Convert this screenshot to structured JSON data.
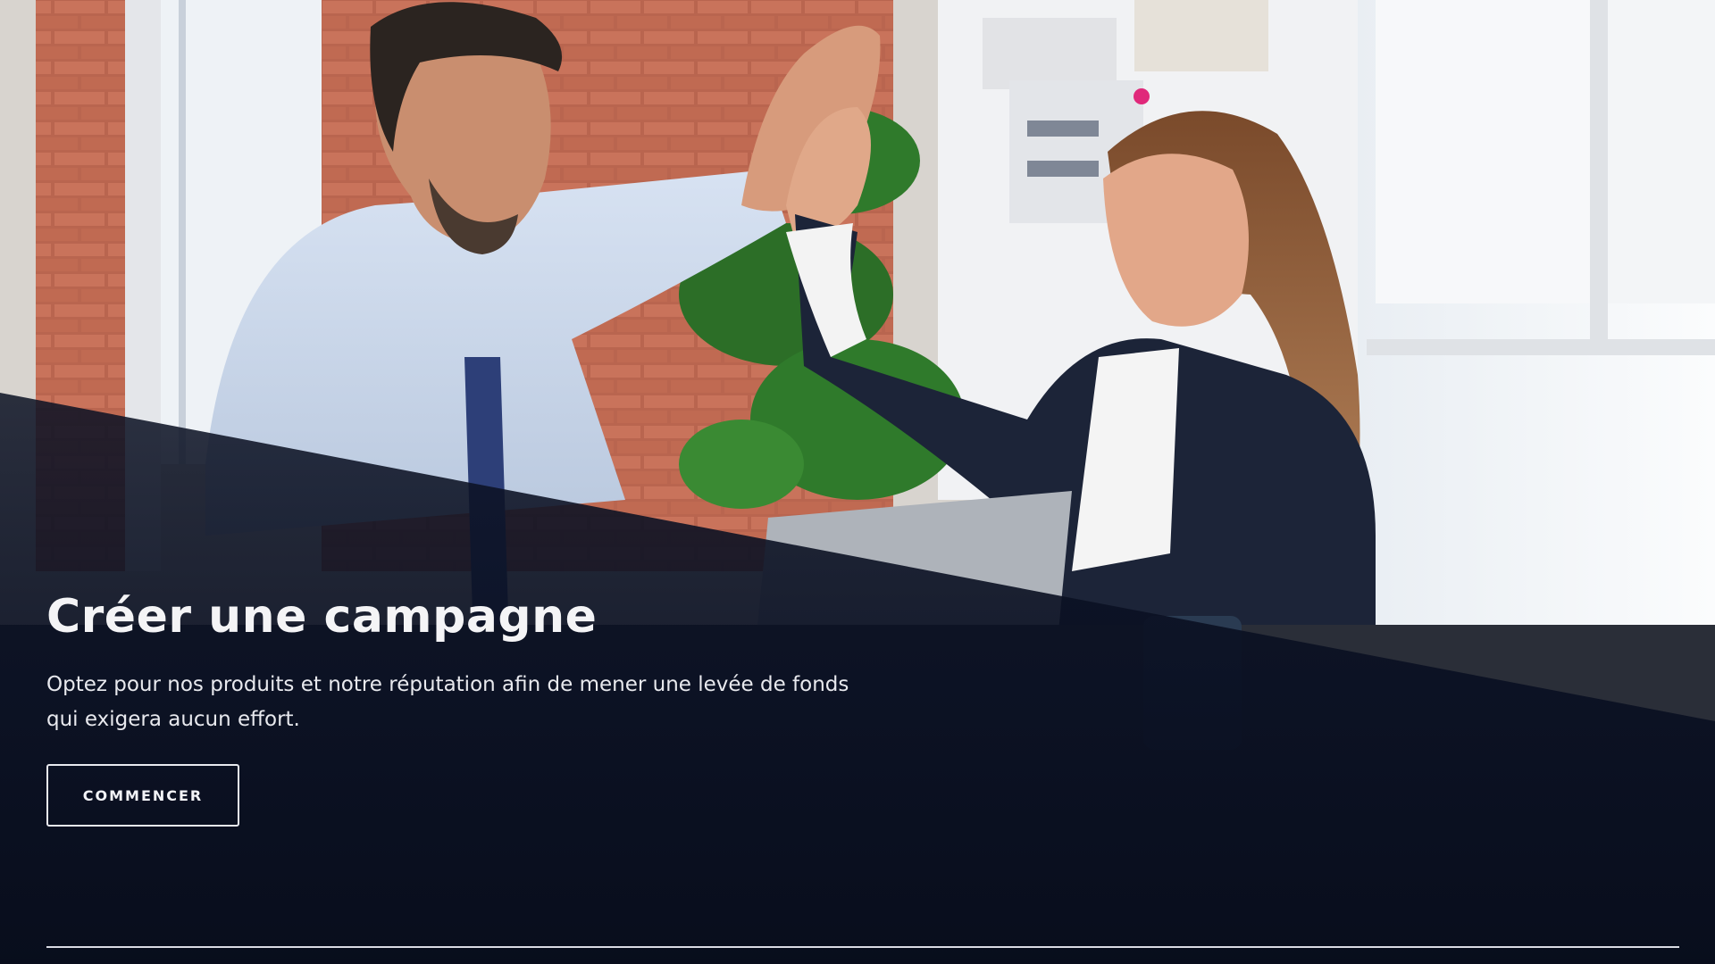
{
  "hero": {
    "title": "Créer une campagne",
    "description": "Optez pour nos produits et notre réputation afin de mener une levée de fonds qui exigera aucun effort.",
    "cta_label": "COMMENCER"
  },
  "colors": {
    "overlay": "#0b1020",
    "text": "#f4f4f6",
    "button_border": "#e9eaf0"
  }
}
